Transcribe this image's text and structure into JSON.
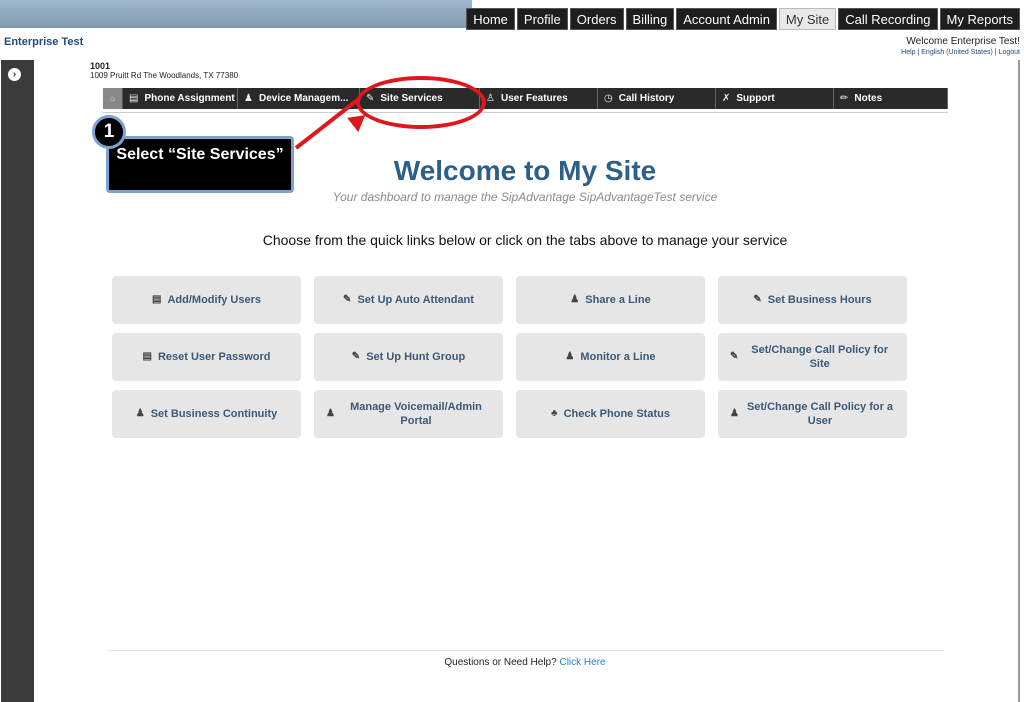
{
  "top_nav": [
    "Home",
    "Profile",
    "Orders",
    "Billing",
    "Account Admin",
    "My Site",
    "Call Recording",
    "My Reports"
  ],
  "active_top_tab": "My Site",
  "enterprise_name": "Enterprise Test",
  "welcome_text": "Welcome Enterprise Test!",
  "header_links": {
    "help": "Help",
    "language": "English (United States)",
    "logout": "Logout"
  },
  "site": {
    "number": "1001",
    "address": "1009 Pruitt Rd The Woodlands, TX 77380"
  },
  "sub_nav": {
    "home_icon": "home-icon",
    "tabs": [
      {
        "label": "Phone Assignment",
        "icon": "list-icon"
      },
      {
        "label": "Device Managem...",
        "icon": "bell-icon"
      },
      {
        "label": "Site Services",
        "icon": "edit-icon"
      },
      {
        "label": "User Features",
        "icon": "user-icon"
      },
      {
        "label": "Call History",
        "icon": "clock-icon"
      },
      {
        "label": "Support",
        "icon": "wrench-icon"
      },
      {
        "label": "Notes",
        "icon": "pencil-icon"
      }
    ]
  },
  "callout": {
    "number": "1",
    "text": "Select “Site Services”"
  },
  "main": {
    "title": "Welcome to My Site",
    "subtitle": "Your dashboard to manage the SipAdvantage SipAdvantageTest service",
    "instructions": "Choose from the quick links below or click on the tabs above to manage your service"
  },
  "quick_links": [
    {
      "label": "Add/Modify Users",
      "icon": "list-icon"
    },
    {
      "label": "Set Up Auto Attendant",
      "icon": "edit-icon"
    },
    {
      "label": "Share a Line",
      "icon": "user-icon"
    },
    {
      "label": "Set Business Hours",
      "icon": "edit-icon"
    },
    {
      "label": "Reset User Password",
      "icon": "list-icon"
    },
    {
      "label": "Set Up Hunt Group",
      "icon": "edit-icon"
    },
    {
      "label": "Monitor a Line",
      "icon": "user-icon"
    },
    {
      "label": "Set/Change Call Policy for Site",
      "icon": "edit-icon"
    },
    {
      "label": "Set Business Continuity",
      "icon": "user-icon"
    },
    {
      "label": "Manage Voicemail/Admin Portal",
      "icon": "user-icon"
    },
    {
      "label": "Check Phone Status",
      "icon": "bell-icon"
    },
    {
      "label": "Set/Change Call Policy for a User",
      "icon": "user-icon"
    }
  ],
  "footer": {
    "text": "Questions or Need Help?",
    "link": "Click Here"
  },
  "colors": {
    "title_blue": "#2d5f8b",
    "annotation_red": "#e0161d",
    "link_blue": "#2d7dd2"
  }
}
